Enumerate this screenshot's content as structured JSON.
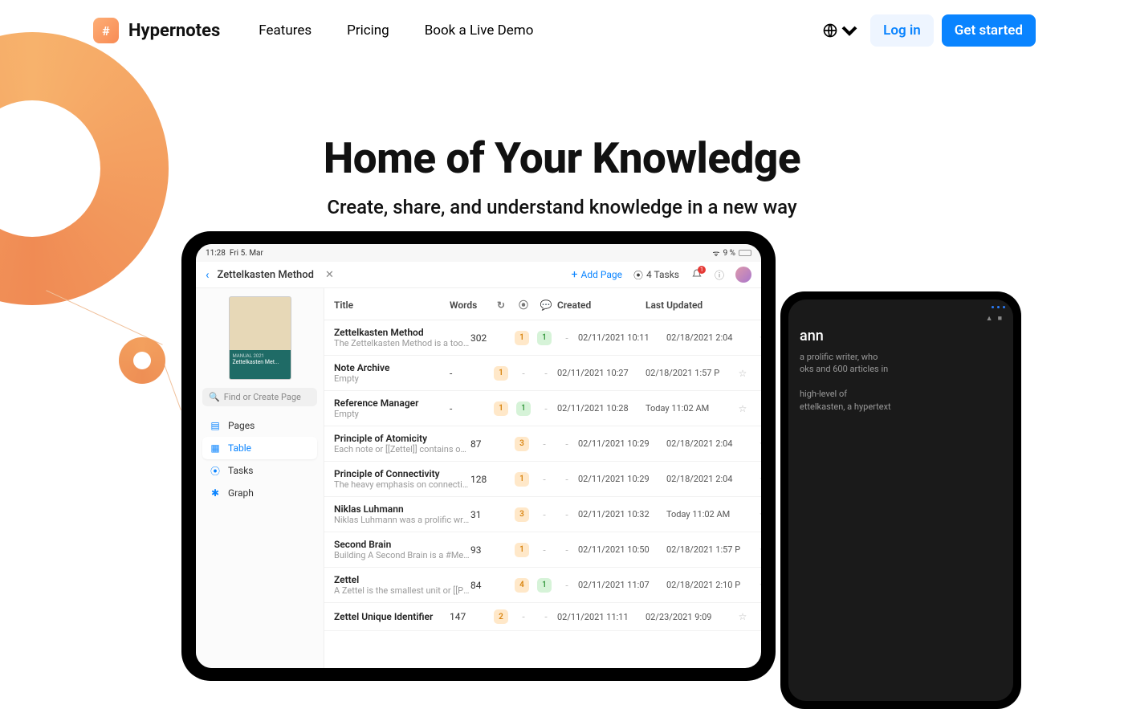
{
  "brand": {
    "name": "Hypernotes"
  },
  "nav": {
    "features": "Features",
    "pricing": "Pricing",
    "demo": "Book a Live Demo"
  },
  "auth": {
    "login": "Log in",
    "cta": "Get started"
  },
  "hero": {
    "title": "Home of Your Knowledge",
    "subtitle": "Create, share, and understand knowledge in a new way"
  },
  "ipad": {
    "status_time": "11:28",
    "status_date": "Fri 5. Mar",
    "battery": "9 %",
    "crumb_title": "Zettelkasten Method",
    "add_page": "Add Page",
    "tasks": "4 Tasks",
    "bell_count": "1",
    "thumb_caption": "Zettelkasten Met...",
    "search_placeholder": "Find or Create Page",
    "side": {
      "pages": "Pages",
      "table": "Table",
      "tasks": "Tasks",
      "graph": "Graph"
    },
    "columns": {
      "title": "Title",
      "words": "Words",
      "created": "Created",
      "updated": "Last Updated"
    },
    "rows": [
      {
        "title": "Zettelkasten Method",
        "sub": "The Zettelkasten Method is a tool to o",
        "words": "302",
        "p1": "1",
        "p2": "1",
        "p3": "-",
        "created": "02/11/2021 10:11",
        "updated": "02/18/2021 2:04"
      },
      {
        "title": "Note Archive",
        "sub": "Empty",
        "words": "-",
        "p1": "1",
        "p2": "",
        "p3": "-",
        "created": "02/11/2021 10:27",
        "updated": "02/18/2021 1:57 P"
      },
      {
        "title": "Reference Manager",
        "sub": "Empty",
        "words": "-",
        "p1": "1",
        "p2": "1",
        "p3": "-",
        "created": "02/11/2021 10:28",
        "updated": "Today 11:02 AM"
      },
      {
        "title": "Principle of Atomicity",
        "sub": "Each note or [[Zettel]] contains one id",
        "words": "87",
        "p1": "3",
        "p2": "-",
        "p3": "-",
        "created": "02/11/2021 10:29",
        "updated": "02/18/2021 2:04"
      },
      {
        "title": "Principle of Connectivity",
        "sub": "The heavy emphasis on connection be",
        "words": "128",
        "p1": "1",
        "p2": "-",
        "p3": "-",
        "created": "02/11/2021 10:29",
        "updated": "02/18/2021 2:04"
      },
      {
        "title": "Niklas Luhmann",
        "sub": "Niklas Luhmann was a prolific writer, w",
        "words": "31",
        "p1": "3",
        "p2": "-",
        "p3": "-",
        "created": "02/11/2021 10:32",
        "updated": "Today 11:02 AM"
      },
      {
        "title": "Second Brain",
        "sub": "Building A Second Brain is a #Method",
        "words": "93",
        "p1": "1",
        "p2": "-",
        "p3": "-",
        "created": "02/11/2021 10:50",
        "updated": "02/18/2021 1:57 P"
      },
      {
        "title": "Zettel",
        "sub": "A Zettel is the smallest unit or [[Princi",
        "words": "84",
        "p1": "4",
        "p2": "1",
        "p3": "-",
        "created": "02/11/2021 11:07",
        "updated": "02/18/2021 2:10 P"
      },
      {
        "title": "Zettel Unique Identifier",
        "sub": "",
        "words": "147",
        "p1": "2",
        "p2": "-",
        "p3": "-",
        "created": "02/11/2021 11:11",
        "updated": "02/23/2021 9:09"
      }
    ]
  },
  "phone": {
    "title": "ann",
    "line1": "a prolific writer, who",
    "line2": "oks and 600 articles in",
    "line3": "high-level of",
    "line4": "ettelkasten, a hypertext"
  }
}
